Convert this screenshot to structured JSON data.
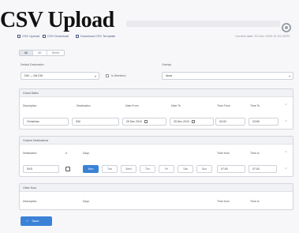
{
  "header": {
    "title": "CSV Upload"
  },
  "toolbar": {
    "upload_label": "CSV Upload",
    "download_label": "CSV Download",
    "template_label": "Download CSV Template",
    "current_date": "Current date: 01 Dec 2019 11:31 CEST"
  },
  "mode_tabs": [
    "All",
    "UK",
    "World"
  ],
  "default_destination": {
    "label": "Default Destination",
    "value": "DW — Sel DW",
    "checkbox_label": "Is Weekend"
  },
  "overlay": {
    "label": "Overlay",
    "value": "None"
  },
  "grand_dates": {
    "title": "Grand Dates",
    "columns": [
      "Description",
      "Destination",
      "Date From",
      "Date To",
      "Time From",
      "Time To"
    ],
    "row": {
      "description": "Christmas",
      "destination": "DW",
      "date_from": "25 Dec 2019",
      "date_to": "25 Dec 2019",
      "time_from": "00:00",
      "time_to": "23:59"
    }
  },
  "custom_destinations": {
    "title": "Custom Destinations",
    "columns": [
      "Destination",
      "#",
      "Days",
      "Time from",
      "Time to"
    ],
    "row": {
      "destination": "DKS",
      "days": [
        "Mon",
        "Tue",
        "Wed",
        "Thu",
        "Fri",
        "Sat",
        "Sun"
      ],
      "selected_day": "Mon",
      "time_from": "07:00",
      "time_to": "07:00"
    }
  },
  "other_hour": {
    "title": "Other Hour",
    "columns": [
      "Description",
      "Days",
      "Time from",
      "Time to"
    ]
  },
  "save_label": "Save",
  "colors": {
    "accent": "#3b82d6",
    "title": "#111111"
  }
}
